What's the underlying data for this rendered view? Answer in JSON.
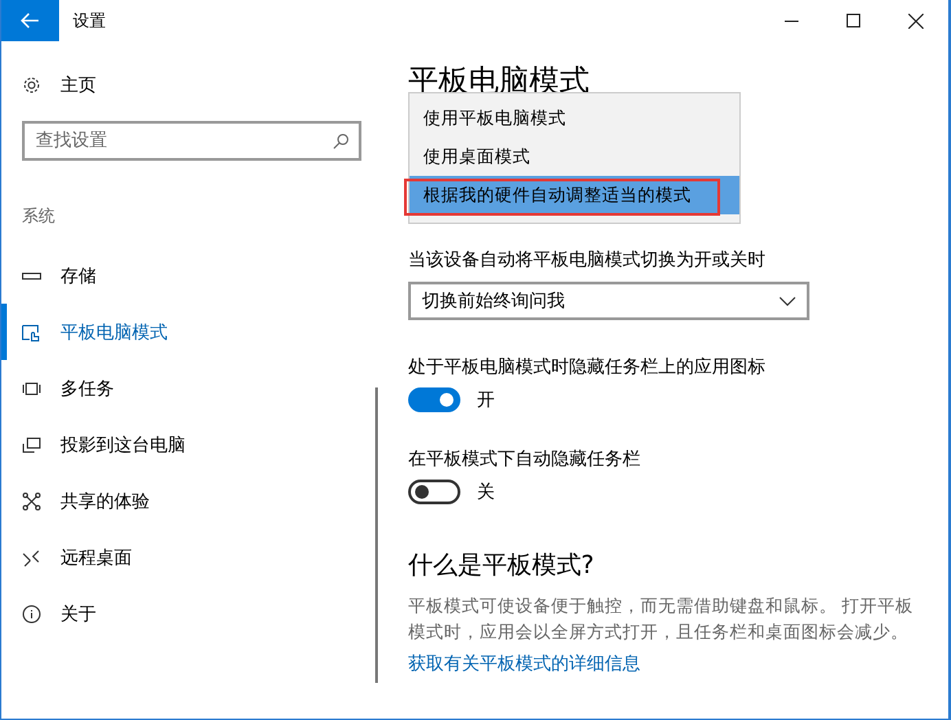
{
  "window": {
    "title": "设置"
  },
  "sidebar": {
    "home": "主页",
    "search": {
      "placeholder": "查找设置"
    },
    "section": "系统",
    "items": [
      {
        "label": "存储",
        "kind": "storage",
        "selected": false
      },
      {
        "label": "平板电脑模式",
        "kind": "tablet",
        "selected": true
      },
      {
        "label": "多任务",
        "kind": "multitask",
        "selected": false
      },
      {
        "label": "投影到这台电脑",
        "kind": "project",
        "selected": false
      },
      {
        "label": "共享的体验",
        "kind": "share",
        "selected": false
      },
      {
        "label": "远程桌面",
        "kind": "remote",
        "selected": false
      },
      {
        "label": "关于",
        "kind": "about",
        "selected": false
      }
    ]
  },
  "content": {
    "title": "平板电脑模式",
    "dropdown": {
      "options": [
        {
          "label": "使用平板电脑模式",
          "selected": false,
          "annotated": false
        },
        {
          "label": "使用桌面模式",
          "selected": false,
          "annotated": false
        },
        {
          "label": "根据我的硬件自动调整适当的模式",
          "selected": true,
          "annotated": true
        }
      ]
    },
    "auto_switch": {
      "label": "当该设备自动将平板电脑模式切换为开或关时",
      "value": "切换前始终询问我"
    },
    "toggles": [
      {
        "label": "处于平板电脑模式时隐藏任务栏上的应用图标",
        "on": true,
        "state_text": "开"
      },
      {
        "label": "在平板模式下自动隐藏任务栏",
        "on": false,
        "state_text": "关"
      }
    ],
    "about": {
      "heading": "什么是平板模式?",
      "text": "平板模式可使设备便于触控，而无需借助键盘和鼠标。 打开平板模式时，应用会以全屏方式打开，且任务栏和桌面图标会减少。",
      "link": "获取有关平板模式的详细信息"
    }
  }
}
